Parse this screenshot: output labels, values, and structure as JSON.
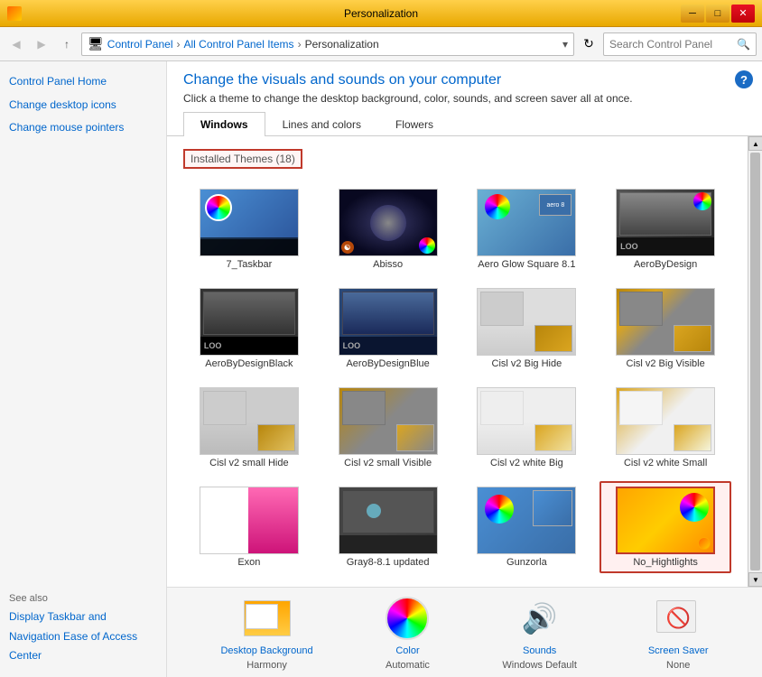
{
  "window": {
    "title": "Personalization",
    "titlebar_icon": "🎨",
    "btn_min": "─",
    "btn_max": "□",
    "btn_close": "✕"
  },
  "navbar": {
    "back_label": "◀",
    "forward_label": "▶",
    "up_label": "↑",
    "crumb1": "Control Panel",
    "crumb2": "All Control Panel Items",
    "crumb3": "Personalization",
    "search_placeholder": "Search Control Panel",
    "refresh_label": "↻"
  },
  "sidebar": {
    "control_home": "Control Panel Home",
    "link1": "Change desktop icons",
    "link2": "Change mouse pointers",
    "see_also": "See also",
    "link3": "Display",
    "link4": "Taskbar and Navigation",
    "link5": "Ease of Access Center"
  },
  "content": {
    "title": "Change the visuals and sounds on your computer",
    "description": "Click a theme to change the desktop background, color, sounds, and screen saver all at once.",
    "tabs": [
      "Windows",
      "Lines and colors",
      "Flowers"
    ],
    "active_tab": "Windows",
    "installed_label": "Installed Themes (18)",
    "themes": [
      {
        "name": "7_Taskbar",
        "type": "taskbar"
      },
      {
        "name": "Abisso",
        "type": "abisso"
      },
      {
        "name": "Aero Glow Square 8.1",
        "type": "aeroglow"
      },
      {
        "name": "AeroByDesign",
        "type": "aerobydesign"
      },
      {
        "name": "AeroByDesignBlack",
        "type": "aerobydesignblack"
      },
      {
        "name": "AeroByDesignBlue",
        "type": "aerobydesignblue"
      },
      {
        "name": "Cisl v2 Big Hide",
        "type": "cislbighide"
      },
      {
        "name": "Cisl v2 Big Visible",
        "type": "cislbigvisible"
      },
      {
        "name": "Cisl v2 small Hide",
        "type": "cislsmallhide"
      },
      {
        "name": "Cisl v2 small Visible",
        "type": "cislsmallvisible"
      },
      {
        "name": "Cisl v2 white Big",
        "type": "cislwhitebig"
      },
      {
        "name": "Cisl v2 white Small",
        "type": "cislwhitesmall"
      },
      {
        "name": "Exon",
        "type": "exon"
      },
      {
        "name": "Gray8-8.1 updated",
        "type": "gray8"
      },
      {
        "name": "Gunzorla",
        "type": "gunzorla"
      },
      {
        "name": "No_Hightlights",
        "type": "nohighlights",
        "selected": true
      }
    ]
  },
  "bottom": {
    "desktop_bg_label": "Desktop Background",
    "desktop_bg_sub": "Harmony",
    "color_label": "Color",
    "color_sub": "Automatic",
    "sounds_label": "Sounds",
    "sounds_sub": "Windows Default",
    "screensaver_label": "Screen Saver",
    "screensaver_sub": "None"
  }
}
